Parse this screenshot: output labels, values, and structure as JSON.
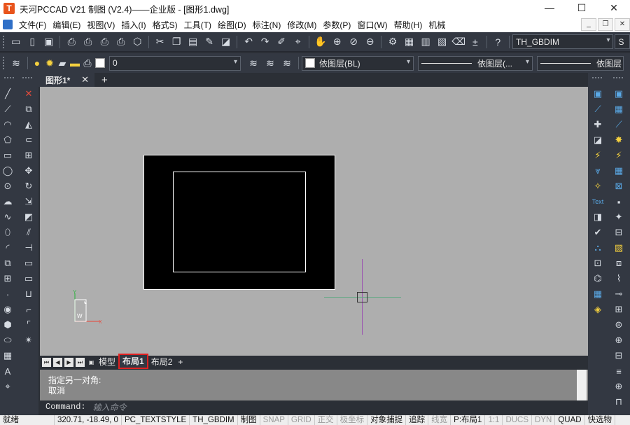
{
  "window": {
    "logo_letter": "T",
    "title": "天河PCCAD V21 制图 (V2.4)——企业版 - [图形1.dwg]",
    "minimize": "—",
    "maximize": "☐",
    "close": "✕"
  },
  "menu": {
    "items": [
      "文件(F)",
      "编辑(E)",
      "视图(V)",
      "插入(I)",
      "格式S)",
      "工具(T)",
      "绘图(D)",
      "标注(N)",
      "修改(M)",
      "参数(P)",
      "窗口(W)",
      "帮助(H)",
      "机械"
    ],
    "mdi_min": "_",
    "mdi_restore": "❐",
    "mdi_close": "✕"
  },
  "toolbar1": {
    "dimstyle_value": "TH_GBDIM",
    "right_value": "S"
  },
  "toolbar2": {
    "layer_value": "0",
    "color_value": "依图层(BL)",
    "linetype_value": "依图层(...",
    "lineweight_value": "依图层"
  },
  "doc_tab": {
    "label": "图形1*",
    "close": "✕",
    "add": "+"
  },
  "right_strip": {
    "text_label": "Text"
  },
  "canvas": {
    "ucs_y": "Y",
    "ucs_w": "W",
    "ucs_x": "X"
  },
  "layout_tabs": {
    "model": "模型",
    "layout1": "布局1",
    "layout2": "布局2",
    "add": "+"
  },
  "command": {
    "history_line1": "指定另一对角:",
    "history_line2": "取消",
    "prompt": "Command:",
    "input_placeholder": "输入命令"
  },
  "status": {
    "left_label": "就绪",
    "coords": "320.71, -18.49, 0",
    "items": [
      "PC_TEXTSTYLE",
      "TH_GBDIM",
      "制图",
      "SNAP",
      "GRID",
      "正交",
      "极坐标",
      "对象捕捉",
      "追踪",
      "线宽",
      "P:布局1",
      "1:1",
      "DUCS",
      "DYN",
      "QUAD",
      "快选物"
    ],
    "off_items": [
      "SNAP",
      "GRID",
      "正交",
      "极坐标",
      "线宽",
      "1:1",
      "DUCS",
      "DYN"
    ]
  },
  "colors": {
    "ui_dark": "#333842",
    "canvas_bg": "#aeaeae",
    "paper": "#000000",
    "highlight_border": "#e02020",
    "crosshair_v": "#9a4fb0",
    "crosshair_h": "#5fa882"
  }
}
